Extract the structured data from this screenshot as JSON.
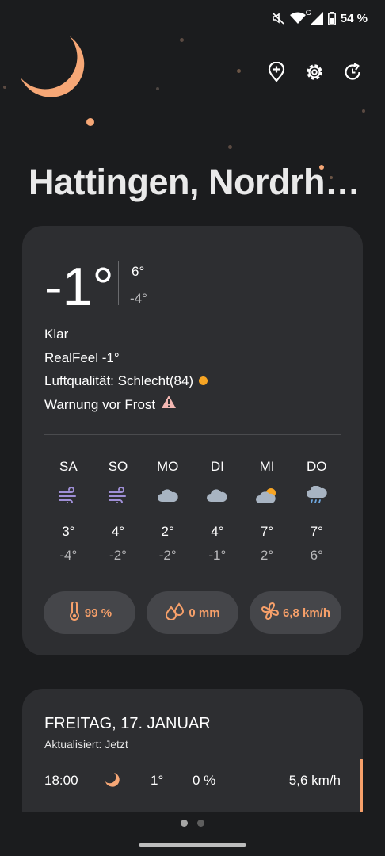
{
  "status": {
    "battery": "54 %",
    "network": "G"
  },
  "header": {
    "city": "Hattingen, Nordrh…"
  },
  "current": {
    "temp": "-1°",
    "high": "6°",
    "low": "-4°",
    "condition": "Klar",
    "realfeel": "RealFeel -1°",
    "air_quality": "Luftqualität: Schlecht(84)",
    "warning": "Warnung vor Frost"
  },
  "forecast": [
    {
      "day": "SA",
      "icon": "wind-icon",
      "high": "3°",
      "low": "-4°"
    },
    {
      "day": "SO",
      "icon": "wind-icon",
      "high": "4°",
      "low": "-2°"
    },
    {
      "day": "MO",
      "icon": "cloud-icon",
      "high": "2°",
      "low": "-2°"
    },
    {
      "day": "DI",
      "icon": "cloud-icon",
      "high": "4°",
      "low": "-1°"
    },
    {
      "day": "MI",
      "icon": "partly-cloudy-icon",
      "high": "7°",
      "low": "2°"
    },
    {
      "day": "DO",
      "icon": "rain-cloud-icon",
      "high": "7°",
      "low": "6°"
    }
  ],
  "stats": {
    "humidity": "99 %",
    "precipitation": "0 mm",
    "wind": "6,8 km/h"
  },
  "daily": {
    "title": "FREITAG, 17. JANUAR",
    "updated": "Aktualisiert: Jetzt",
    "hour": {
      "time": "18:00",
      "temp": "1°",
      "precip": "0 %",
      "wind": "5,6 km/h"
    }
  },
  "colors": {
    "accent": "#f7a06a",
    "background": "#1b1c1e",
    "card": "#2d2e31",
    "aqi_dot": "#f7a524"
  }
}
